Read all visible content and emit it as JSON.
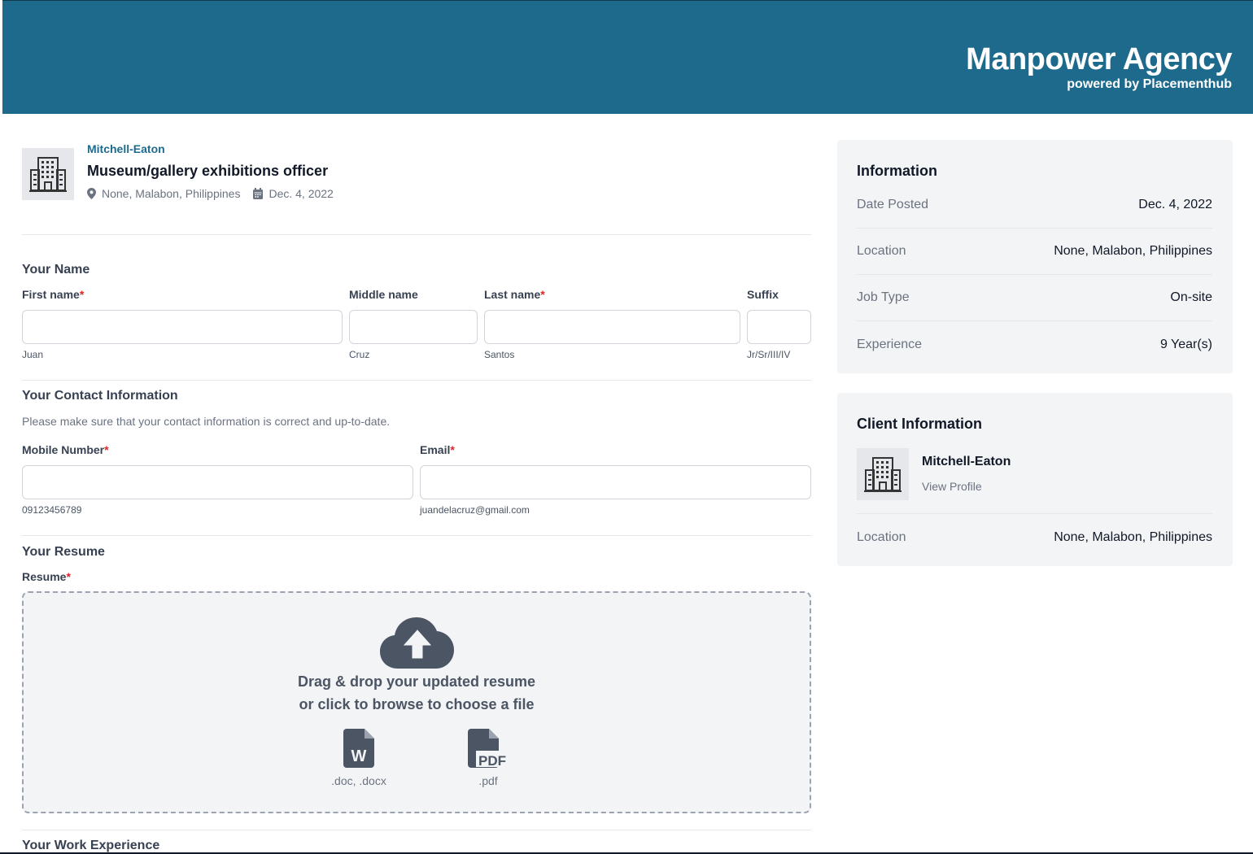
{
  "header": {
    "title": "Manpower Agency",
    "subtitle": "powered by Placementhub"
  },
  "job": {
    "company": "Mitchell-Eaton",
    "title": "Museum/gallery exhibitions officer",
    "location": "None, Malabon, Philippines",
    "date": "Dec. 4, 2022"
  },
  "name_section": {
    "title": "Your Name",
    "first": {
      "label": "First name",
      "hint": "Juan",
      "value": ""
    },
    "middle": {
      "label": "Middle name",
      "hint": "Cruz",
      "value": ""
    },
    "last": {
      "label": "Last name",
      "hint": "Santos",
      "value": ""
    },
    "suffix": {
      "label": "Suffix",
      "hint": "Jr/Sr/III/IV",
      "value": ""
    },
    "required_mark": "*"
  },
  "contact_section": {
    "title": "Your Contact Information",
    "description": "Please make sure that your contact information is correct and up-to-date.",
    "mobile": {
      "label": "Mobile Number",
      "hint": "09123456789",
      "value": ""
    },
    "email": {
      "label": "Email",
      "hint": "juandelacruz@gmail.com",
      "value": ""
    }
  },
  "resume_section": {
    "title": "Your Resume",
    "label": "Resume",
    "drop_line1": "Drag & drop your updated resume",
    "drop_line2": "or click to browse to choose a file",
    "doc_types": ".doc, .docx",
    "pdf_types": ".pdf",
    "doc_icon_letter": "W",
    "pdf_icon_text": "PDF"
  },
  "work_section": {
    "title": "Your Work Experience"
  },
  "info_card": {
    "title": "Information",
    "rows": [
      {
        "label": "Date Posted",
        "value": "Dec. 4, 2022"
      },
      {
        "label": "Location",
        "value": "None, Malabon, Philippines"
      },
      {
        "label": "Job Type",
        "value": "On-site"
      },
      {
        "label": "Experience",
        "value": "9 Year(s)"
      }
    ]
  },
  "client_card": {
    "title": "Client Information",
    "name": "Mitchell-Eaton",
    "link": "View Profile",
    "location_label": "Location",
    "location_value": "None, Malabon, Philippines"
  },
  "colors": {
    "brand": "#1e6a8c",
    "required": "#dc2626",
    "panel": "#f3f4f6"
  },
  "icons": [
    "building-icon",
    "map-pin-icon",
    "calendar-icon",
    "cloud-upload-icon",
    "word-file-icon",
    "pdf-file-icon"
  ]
}
